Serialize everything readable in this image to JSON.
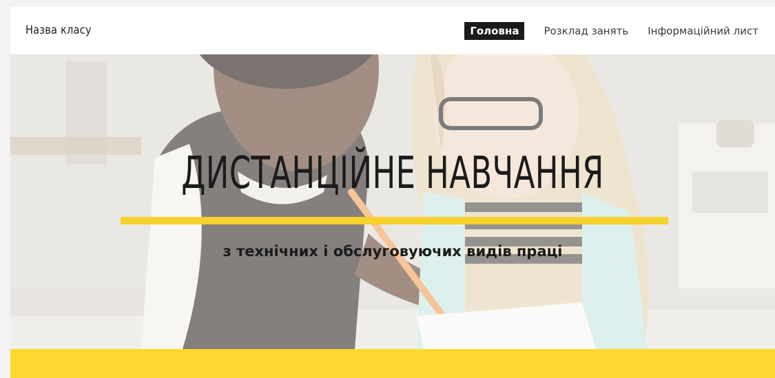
{
  "header": {
    "site_title": "Назва класу",
    "nav": [
      {
        "label": "Головна",
        "active": true
      },
      {
        "label": "Розклад занять",
        "active": false
      },
      {
        "label": "Інформаційний лист",
        "active": false
      }
    ]
  },
  "hero": {
    "title": "ДИСТАНЦІЙНЕ НАВЧАННЯ",
    "subtitle": "з технічних і обслуговуючих видів праці",
    "image_subject": "two-children-studying-photo"
  },
  "colors": {
    "accent_yellow": "#fdd82e",
    "active_nav_bg": "#1b1b1b",
    "text_dark": "#1b1b1b"
  }
}
